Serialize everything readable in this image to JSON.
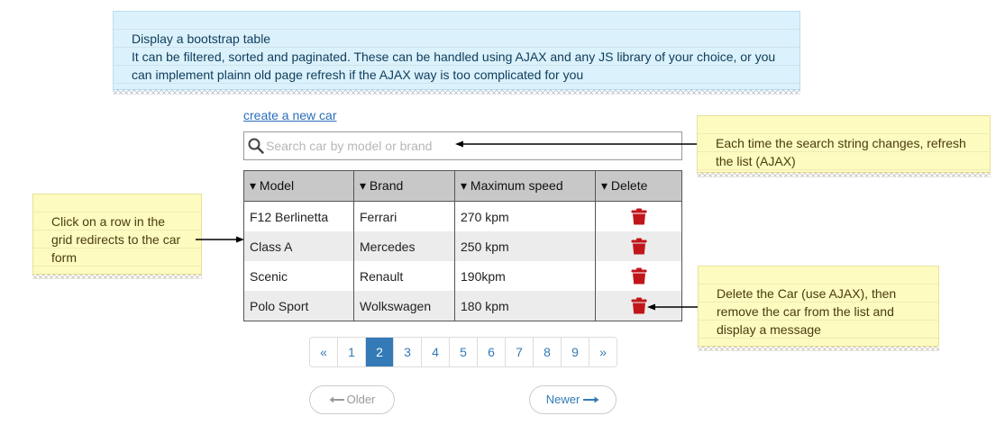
{
  "notes": {
    "header": {
      "lines": [
        "Display a bootstrap table",
        "It can be filtered, sorted and paginated. These can be handled using AJAX and any JS library of your choice, or you",
        "can implement plainn old page refresh if the AJAX way is too complicated for you"
      ]
    },
    "search": {
      "lines": [
        "Each time the search string changes, refresh",
        "the list (AJAX)"
      ]
    },
    "row_click": {
      "lines": [
        "Click on a row in the",
        "grid redirects to the car",
        "form"
      ]
    },
    "delete": {
      "lines": [
        "Delete the Car (use AJAX), then",
        "remove the car from the list and",
        "display a message"
      ]
    }
  },
  "create_link": "create a new car",
  "search": {
    "placeholder": "Search car by model or brand",
    "value": ""
  },
  "table": {
    "columns": [
      "▾ Model",
      "▾ Brand",
      "▾ Maximum speed",
      "▾ Delete"
    ],
    "rows": [
      {
        "model": "F12 Berlinetta",
        "brand": "Ferrari",
        "speed": "270 kpm"
      },
      {
        "model": "Class A",
        "brand": "Mercedes",
        "speed": "250 kpm"
      },
      {
        "model": "Scenic",
        "brand": "Renault",
        "speed": "190kpm"
      },
      {
        "model": "Polo Sport",
        "brand": "Wolkswagen",
        "speed": "180 kpm"
      }
    ]
  },
  "pagination": {
    "prev": "«",
    "pages": [
      "1",
      "2",
      "3",
      "4",
      "5",
      "6",
      "7",
      "8",
      "9"
    ],
    "active_page": "2",
    "next": "»"
  },
  "pager": {
    "older": "Older",
    "newer": "Newer"
  },
  "colors": {
    "accent": "#337ab7",
    "trash": "#c0161a",
    "link": "#2a6ebb"
  },
  "icons": {
    "search": "search-icon",
    "delete": "trash-icon",
    "older": "arrow-left-icon",
    "newer": "arrow-right-icon"
  }
}
